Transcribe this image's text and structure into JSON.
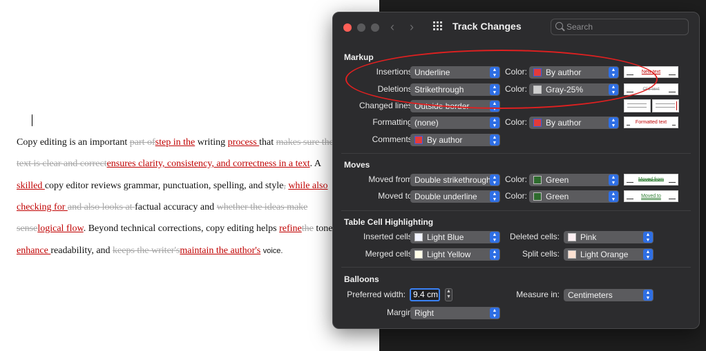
{
  "document": {
    "lines": [
      [
        [
          "n",
          "Copy editing is an important "
        ],
        [
          "d",
          "part of"
        ],
        [
          "i",
          "step in the"
        ],
        [
          "n",
          " writing "
        ],
        [
          "i",
          "process "
        ],
        [
          "n",
          "that "
        ],
        [
          "d",
          "makes sure the"
        ]
      ],
      [
        [
          "d",
          "text is clear and correct"
        ],
        [
          "i",
          "ensures clarity, consistency, and correctness in a text"
        ],
        [
          "n",
          ". A"
        ]
      ],
      [
        [
          "i",
          "skilled "
        ],
        [
          "n",
          "copy editor reviews grammar, punctuation, spelling, and style"
        ],
        [
          "d",
          ","
        ],
        [
          "n",
          " "
        ],
        [
          "i",
          "while also"
        ]
      ],
      [
        [
          "i",
          "checking for "
        ],
        [
          "d",
          "and also looks at "
        ],
        [
          "n",
          "factual accuracy and "
        ],
        [
          "d",
          "whether the ideas make"
        ]
      ],
      [
        [
          "d",
          "sense"
        ],
        [
          "i",
          "logical flow"
        ],
        [
          "n",
          ". Beyond technical corrections, copy editing helps "
        ],
        [
          "i",
          "refine"
        ],
        [
          "d",
          "the"
        ],
        [
          "n",
          " tone,"
        ]
      ],
      [
        [
          "i",
          "enhance "
        ],
        [
          "n",
          "readability, and "
        ],
        [
          "d",
          "keeps the writer's"
        ],
        [
          "i",
          "maintain the author's"
        ],
        [
          "n",
          " "
        ],
        [
          "s",
          "voice."
        ]
      ]
    ]
  },
  "dialog": {
    "title": "Track Changes",
    "search_placeholder": "Search",
    "icons": {
      "back": "chevron-left-icon",
      "forward": "chevron-right-icon",
      "grid": "grid-icon",
      "search": "search-icon"
    },
    "markup": {
      "title": "Markup",
      "insertions": {
        "label": "Insertions:",
        "value": "Underline",
        "color_label": "Color:",
        "color": "By author",
        "preview": "New text"
      },
      "deletions": {
        "label": "Deletions:",
        "value": "Strikethrough",
        "color_label": "Color:",
        "color": "Gray-25%",
        "preview": "Old text"
      },
      "changed_lines": {
        "label": "Changed lines:",
        "value": "Outside border"
      },
      "formatting": {
        "label": "Formatting:",
        "value": "(none)",
        "color_label": "Color:",
        "color": "By author",
        "preview": "Formatted text"
      },
      "comments": {
        "label": "Comments:",
        "value": "By author"
      }
    },
    "moves": {
      "title": "Moves",
      "moved_from": {
        "label": "Moved from:",
        "value": "Double strikethrough",
        "color_label": "Color:",
        "color": "Green",
        "preview": "Moved from"
      },
      "moved_to": {
        "label": "Moved to:",
        "value": "Double underline",
        "color_label": "Color:",
        "color": "Green",
        "preview": "Moved to"
      }
    },
    "table": {
      "title": "Table Cell Highlighting",
      "inserted": {
        "label": "Inserted cells:",
        "value": "Light Blue"
      },
      "deleted": {
        "label": "Deleted cells:",
        "value": "Pink"
      },
      "merged": {
        "label": "Merged cells:",
        "value": "Light Yellow"
      },
      "split": {
        "label": "Split cells:",
        "value": "Light Orange"
      }
    },
    "balloons": {
      "title": "Balloons",
      "width_label": "Preferred width:",
      "width_value": "9.4 cm",
      "measure_label": "Measure in:",
      "measure_value": "Centimeters",
      "margin_label": "Margin:",
      "margin_value": "Right"
    }
  },
  "colors": {
    "insertion": "#c00000",
    "deletion": "#a6a6a6",
    "accent": "#2f6fe4",
    "annotation": "#e02020",
    "by_author_swatch": "#e23b3b",
    "gray_swatch": "#cfcfcf",
    "green_swatch": "#2e6b2e"
  }
}
